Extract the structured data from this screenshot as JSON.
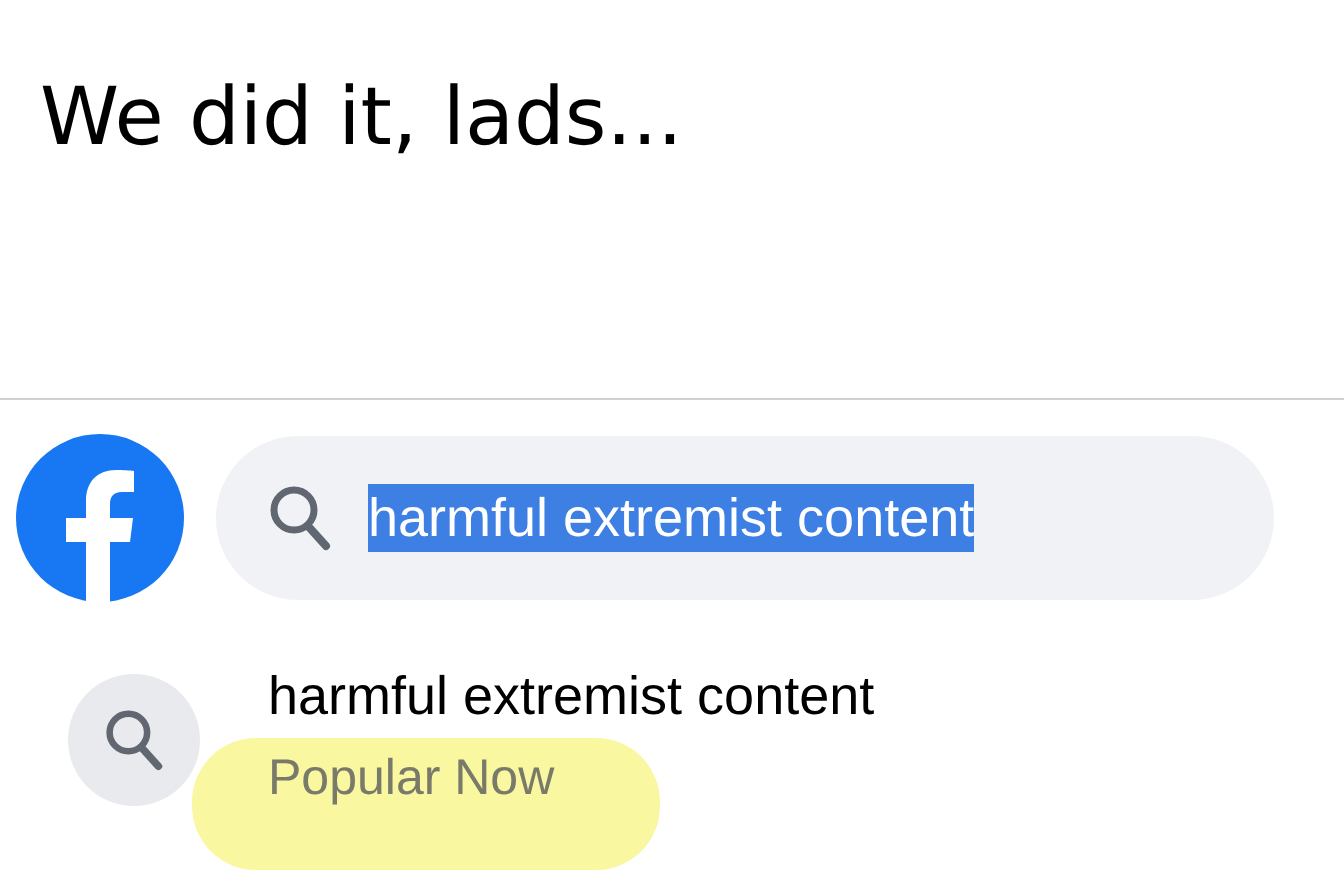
{
  "caption": "We did it, lads...",
  "search": {
    "value": "harmful extremist content",
    "selected": true
  },
  "suggestions": [
    {
      "title": "harmful extremist content",
      "subtitle": "Popular Now",
      "highlighted": true
    }
  ]
}
